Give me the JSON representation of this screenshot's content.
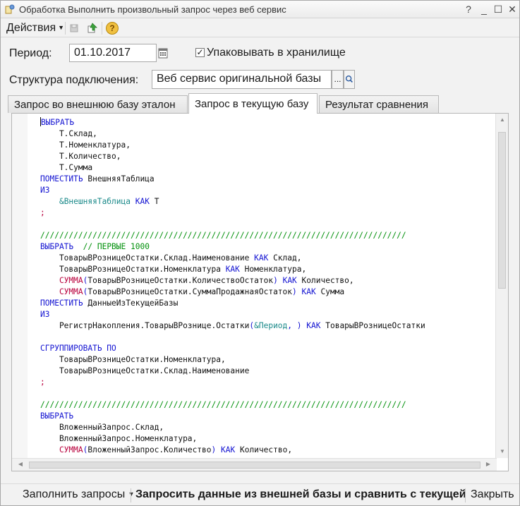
{
  "window": {
    "title": "Обработка  Выполнить произвольный запрос через веб сервис",
    "controls": {
      "help": "?",
      "minimize": "_",
      "maximize": "☐",
      "close": "✕"
    }
  },
  "toolbar": {
    "actions_label": "Действия",
    "help_icon": "?"
  },
  "form": {
    "period_label": "Период:",
    "period_value": "01.10.2017",
    "pack_checkbox_label": "Упаковывать в хранилище",
    "pack_checked": true,
    "structure_label": "Структура подключения:",
    "structure_value": "Веб сервис оригинальной базы",
    "select_button": "..."
  },
  "tabs": [
    {
      "label": "Запрос во внешнюю базу эталон",
      "active": false
    },
    {
      "label": "Запрос в текущую базу",
      "active": true
    },
    {
      "label": "Результат сравнения",
      "active": false
    }
  ],
  "editor": {
    "lines": [
      [
        [
          "kw",
          "ВЫБРАТЬ"
        ]
      ],
      [
        [
          "tx",
          "    Т.Склад,"
        ]
      ],
      [
        [
          "tx",
          "    Т.Номенклатура,"
        ]
      ],
      [
        [
          "tx",
          "    Т.Количество,"
        ]
      ],
      [
        [
          "tx",
          "    Т.Сумма"
        ]
      ],
      [
        [
          "kw",
          "ПОМЕСТИТЬ"
        ],
        [
          "tx",
          " ВнешняяТаблица"
        ]
      ],
      [
        [
          "kw",
          "ИЗ"
        ]
      ],
      [
        [
          "tx",
          "    "
        ],
        [
          "pa",
          "&ВнешняяТаблица"
        ],
        [
          "tx",
          " "
        ],
        [
          "kw",
          "КАК"
        ],
        [
          "tx",
          " Т"
        ]
      ],
      [
        [
          "fn",
          ";"
        ]
      ],
      [
        [
          "tx",
          ""
        ]
      ],
      [
        [
          "cm",
          "/////////////////////////////////////////////////////////////////////////////"
        ]
      ],
      [
        [
          "kw",
          "ВЫБРАТЬ"
        ],
        [
          "tx",
          "  "
        ],
        [
          "cm",
          "// ПЕРВЫЕ 1000"
        ]
      ],
      [
        [
          "tx",
          "    ТоварыВРозницеОстатки.Склад.Наименование "
        ],
        [
          "kw",
          "КАК"
        ],
        [
          "tx",
          " Склад,"
        ]
      ],
      [
        [
          "tx",
          "    ТоварыВРозницеОстатки.Номенклатура "
        ],
        [
          "kw",
          "КАК"
        ],
        [
          "tx",
          " Номенклатура,"
        ]
      ],
      [
        [
          "tx",
          "    "
        ],
        [
          "fn",
          "СУММА"
        ],
        [
          "kw",
          "("
        ],
        [
          "tx",
          "ТоварыВРозницеОстатки.КоличествоОстаток"
        ],
        [
          "kw",
          ")"
        ],
        [
          "tx",
          " "
        ],
        [
          "kw",
          "КАК"
        ],
        [
          "tx",
          " Количество,"
        ]
      ],
      [
        [
          "tx",
          "    "
        ],
        [
          "fn",
          "СУММА"
        ],
        [
          "kw",
          "("
        ],
        [
          "tx",
          "ТоварыВРозницеОстатки.СуммаПродажнаяОстаток"
        ],
        [
          "kw",
          ")"
        ],
        [
          "tx",
          " "
        ],
        [
          "kw",
          "КАК"
        ],
        [
          "tx",
          " Сумма"
        ]
      ],
      [
        [
          "kw",
          "ПОМЕСТИТЬ"
        ],
        [
          "tx",
          " ДанныеИзТекущейБазы"
        ]
      ],
      [
        [
          "kw",
          "ИЗ"
        ]
      ],
      [
        [
          "tx",
          "    РегистрНакопления.ТоварыВРознице.Остатки"
        ],
        [
          "kw",
          "("
        ],
        [
          "pa",
          "&Период"
        ],
        [
          "kw",
          ","
        ],
        [
          "tx",
          " "
        ],
        [
          "kw",
          ")"
        ],
        [
          "tx",
          " "
        ],
        [
          "kw",
          "КАК"
        ],
        [
          "tx",
          " ТоварыВРозницеОстатки"
        ]
      ],
      [
        [
          "tx",
          ""
        ]
      ],
      [
        [
          "kw",
          "СГРУППИРОВАТЬ ПО"
        ]
      ],
      [
        [
          "tx",
          "    ТоварыВРозницеОстатки.Номенклатура,"
        ]
      ],
      [
        [
          "tx",
          "    ТоварыВРозницеОстатки.Склад.Наименование"
        ]
      ],
      [
        [
          "fn",
          ";"
        ]
      ],
      [
        [
          "tx",
          ""
        ]
      ],
      [
        [
          "cm",
          "/////////////////////////////////////////////////////////////////////////////"
        ]
      ],
      [
        [
          "kw",
          "ВЫБРАТЬ"
        ]
      ],
      [
        [
          "tx",
          "    ВложенныйЗапрос.Склад,"
        ]
      ],
      [
        [
          "tx",
          "    ВложенныйЗапрос.Номенклатура,"
        ]
      ],
      [
        [
          "tx",
          "    "
        ],
        [
          "fn",
          "СУММА"
        ],
        [
          "kw",
          "("
        ],
        [
          "tx",
          "ВложенныйЗапрос.Количество"
        ],
        [
          "kw",
          ")"
        ],
        [
          "tx",
          " "
        ],
        [
          "kw",
          "КАК"
        ],
        [
          "tx",
          " Количество,"
        ]
      ]
    ]
  },
  "bottom": {
    "fill_queries": "Заполнить запросы",
    "request_compare": "Запросить данные из внешней базы и сравнить с текущей",
    "close": "Закрыть"
  },
  "colors": {
    "keyword": "#1414d2",
    "function": "#b8003c",
    "comment": "#00900a",
    "parameter": "#1b8a8a"
  }
}
